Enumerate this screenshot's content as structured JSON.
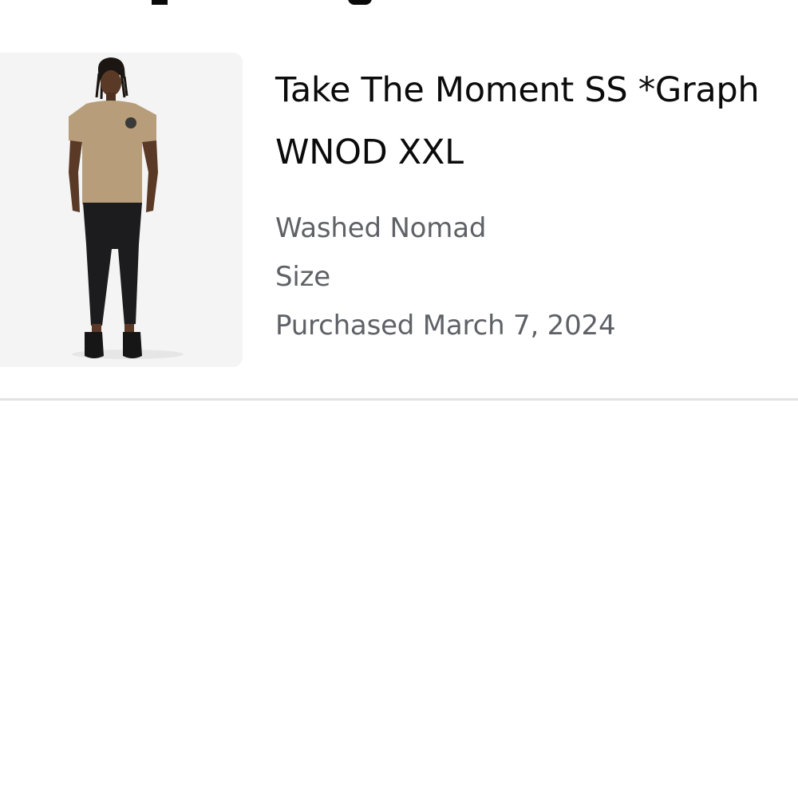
{
  "order_item": {
    "title_line1": "Take The Moment SS *Graph",
    "title_line2": "WNOD XXL",
    "color": "Washed Nomad",
    "size_label": "Size",
    "purchased": "Purchased March 7, 2024",
    "image_alt": "product-photo-man-in-tan-tshirt"
  },
  "colors": {
    "title": "#0b0b0b",
    "meta": "#5f6166",
    "divider": "#e2e2e2",
    "thumb_bg": "#f4f4f4"
  }
}
